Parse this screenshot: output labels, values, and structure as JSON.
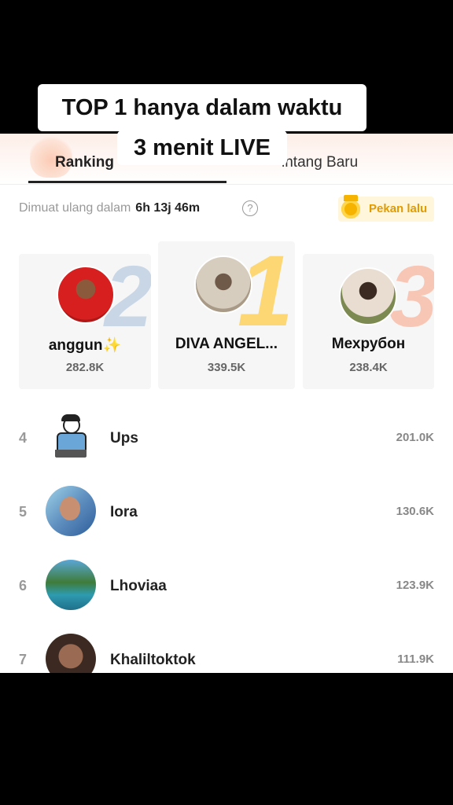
{
  "overlay_caption": {
    "line1": "TOP 1 hanya dalam waktu",
    "line2": "3 menit LIVE"
  },
  "tabs": {
    "left": "Ranking",
    "right": "intang Baru"
  },
  "refresh": {
    "label": "Dimuat ulang dalam",
    "time": "6h 13j 46m",
    "help_glyph": "?"
  },
  "last_week_button": {
    "label": "Pekan lalu"
  },
  "podium": [
    {
      "rank": "2",
      "name": "anggun✨",
      "score": "282.8K"
    },
    {
      "rank": "1",
      "name": "DIVA ANGEL...",
      "score": "339.5K"
    },
    {
      "rank": "3",
      "name": "Мехрубон",
      "score": "238.4K"
    }
  ],
  "list": [
    {
      "rank": "4",
      "name": "Ups",
      "score": "201.0K"
    },
    {
      "rank": "5",
      "name": "Iora",
      "score": "130.6K"
    },
    {
      "rank": "6",
      "name": "Lhoviaa",
      "score": "123.9K"
    },
    {
      "rank": "7",
      "name": "Khaliltoktok",
      "score": "111.9K"
    }
  ]
}
